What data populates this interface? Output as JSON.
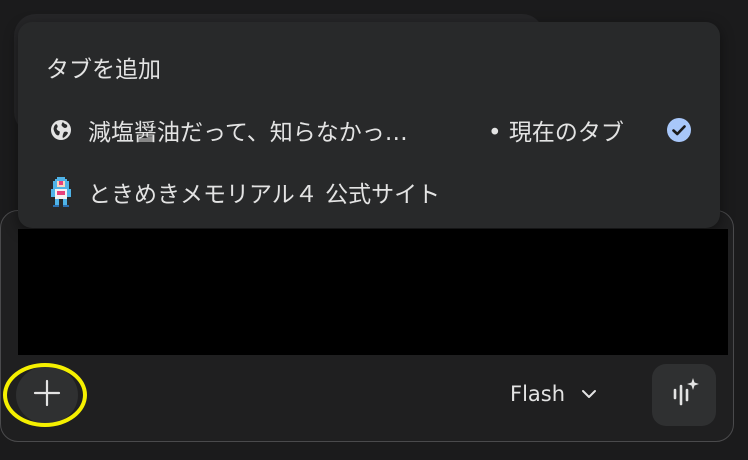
{
  "menu": {
    "heading": "タブを追加",
    "items": [
      {
        "label": "減塩醤油だって、知らなかっ…",
        "current": "• 現在のタブ",
        "icon": "globe-icon",
        "selected": true
      },
      {
        "label": "ときめきメモリアル４ 公式サイト",
        "icon": "pixel-character-favicon",
        "selected": false
      }
    ]
  },
  "toolbar": {
    "model_label": "Flash",
    "plus_icon": "plus-icon",
    "mic_icon": "voice-sparkle-icon"
  },
  "colors": {
    "accent_check": "#a8c7fa",
    "highlight": "#f5f000"
  }
}
